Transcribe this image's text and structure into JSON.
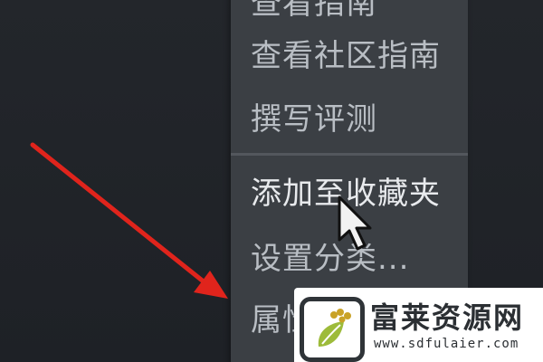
{
  "context_menu": {
    "items": [
      {
        "label": "查看指南",
        "state": "cut-off"
      },
      {
        "label": "查看社区指南",
        "state": "normal"
      },
      {
        "label": "撰写评测",
        "state": "normal"
      },
      {
        "label": "添加至收藏夹",
        "state": "hovered"
      },
      {
        "label": "设置分类...",
        "state": "normal"
      },
      {
        "label": "属性",
        "state": "cut-off"
      }
    ]
  },
  "annotation": {
    "arrow_color": "#e0241c"
  },
  "cursor": {
    "icon": "mouse-pointer-icon"
  },
  "watermark": {
    "title": "富莱资源网",
    "url": "www.sdfulaier.com",
    "logo_icon": "wheat-leaf-icon",
    "accent_color": "#c9a227"
  }
}
